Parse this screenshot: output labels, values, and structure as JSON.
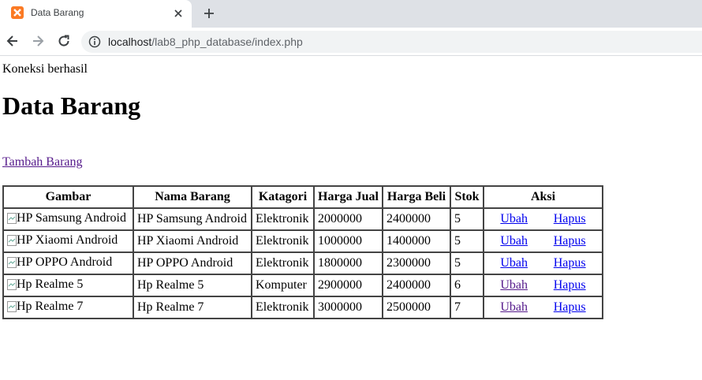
{
  "browser": {
    "tab_title": "Data Barang",
    "url_host": "localhost",
    "url_path": "/lab8_php_database/index.php"
  },
  "page": {
    "status": "Koneksi berhasil",
    "title": "Data Barang",
    "add_link": "Tambah Barang"
  },
  "table": {
    "headers": [
      "Gambar",
      "Nama Barang",
      "Katagori",
      "Harga Jual",
      "Harga Beli",
      "Stok",
      "Aksi"
    ],
    "rows": [
      {
        "gambar_alt": "HP Samsung Android",
        "nama": "HP Samsung Android",
        "kategori": "Elektronik",
        "harga_jual": "2000000",
        "harga_beli": "2400000",
        "stok": "5",
        "ubah": "Ubah",
        "hapus": "Hapus"
      },
      {
        "gambar_alt": "HP Xiaomi Android",
        "nama": "HP Xiaomi Android",
        "kategori": "Elektronik",
        "harga_jual": "1000000",
        "harga_beli": "1400000",
        "stok": "5",
        "ubah": "Ubah",
        "hapus": "Hapus"
      },
      {
        "gambar_alt": "HP OPPO Android",
        "nama": "HP OPPO Android",
        "kategori": "Elektronik",
        "harga_jual": "1800000",
        "harga_beli": "2300000",
        "stok": "5",
        "ubah": "Ubah",
        "hapus": "Hapus"
      },
      {
        "gambar_alt": "Hp Realme 5",
        "nama": "Hp Realme 5",
        "kategori": "Komputer",
        "harga_jual": "2900000",
        "harga_beli": "2400000",
        "stok": "6",
        "ubah": "Ubah",
        "hapus": "Hapus"
      },
      {
        "gambar_alt": "Hp Realme 7",
        "nama": "Hp Realme 7",
        "kategori": "Elektronik",
        "harga_jual": "3000000",
        "harga_beli": "2500000",
        "stok": "7",
        "ubah": "Ubah",
        "hapus": "Hapus"
      }
    ]
  },
  "colors": {
    "link": "#0000ee",
    "visited_link": "#551a8b",
    "favicon": "#fb7a24",
    "tabbar": "#dee1e6"
  }
}
